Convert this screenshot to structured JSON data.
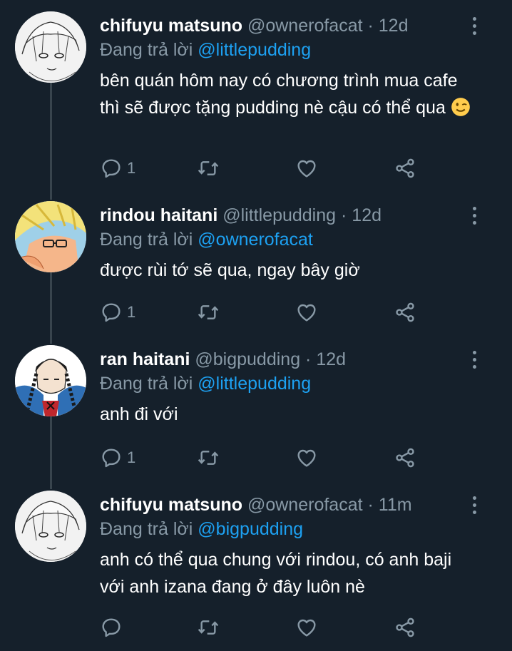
{
  "tweets": [
    {
      "name": "chifuyu matsuno",
      "handle": "@ownerofacat",
      "time": "12d",
      "replying_label": "Đang trả lời",
      "replying_to": "@littlepudding",
      "text": "bên quán hôm nay có chương trình mua cafe thì sẽ được tặng pudding nè cậu có thể qua",
      "emoji": "winking-face",
      "reply_count": "1",
      "avatar": "chifuyu-avatar"
    },
    {
      "name": "rindou haitani",
      "handle": "@littlepudding",
      "time": "12d",
      "replying_label": "Đang trả lời",
      "replying_to": "@ownerofacat",
      "text": "được rùi tớ sẽ qua, ngay bây giờ",
      "reply_count": "1",
      "avatar": "rindou-avatar"
    },
    {
      "name": "ran haitani",
      "handle": "@bigpudding",
      "time": "12d",
      "replying_label": "Đang trả lời",
      "replying_to": "@littlepudding",
      "text": "anh đi với",
      "reply_count": "1",
      "avatar": "ran-avatar"
    },
    {
      "name": "chifuyu matsuno",
      "handle": "@ownerofacat",
      "time": "11m",
      "replying_label": "Đang trả lời",
      "replying_to": "@bigpudding",
      "text": "anh có thể qua chung với rindou, có anh baji với anh izana đang ở đây luôn nè",
      "reply_count": "",
      "avatar": "chifuyu-avatar"
    }
  ],
  "separator": "·",
  "colors": {
    "background": "#15202b",
    "secondary_text": "#8899a6",
    "mention": "#1da1f2",
    "thread_line": "#38444d"
  },
  "icons": [
    "reply-icon",
    "retweet-icon",
    "like-icon",
    "share-icon",
    "more-options-icon"
  ]
}
